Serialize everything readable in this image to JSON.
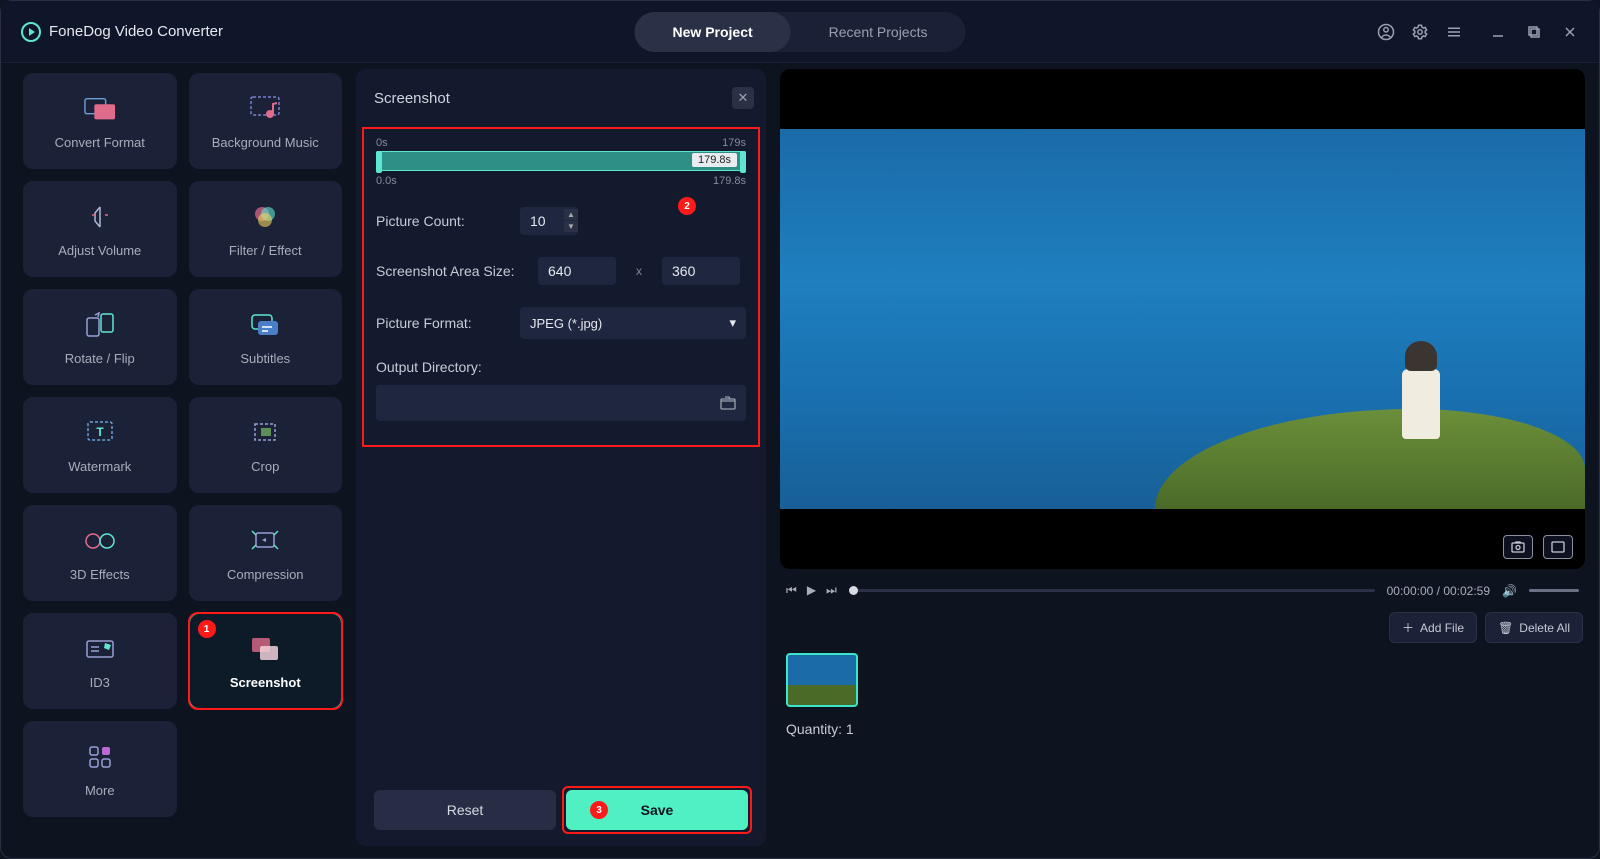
{
  "app": {
    "title": "FoneDog Video Converter"
  },
  "tabs": {
    "new": "New Project",
    "recent": "Recent Projects"
  },
  "sidebar": {
    "items": [
      {
        "label": "Convert Format"
      },
      {
        "label": "Background Music"
      },
      {
        "label": "Adjust Volume"
      },
      {
        "label": "Filter / Effect"
      },
      {
        "label": "Rotate / Flip"
      },
      {
        "label": "Subtitles"
      },
      {
        "label": "Watermark"
      },
      {
        "label": "Crop"
      },
      {
        "label": "3D Effects"
      },
      {
        "label": "Compression"
      },
      {
        "label": "ID3"
      },
      {
        "label": "Screenshot"
      },
      {
        "label": "More"
      }
    ]
  },
  "panel": {
    "title": "Screenshot",
    "range": {
      "startTop": "0s",
      "endTop": "179s",
      "tag": "179.8s",
      "startBot": "0.0s",
      "endBot": "179.8s"
    },
    "picCountLabel": "Picture Count:",
    "picCountVal": "10",
    "areaLabel": "Screenshot Area Size:",
    "areaW": "640",
    "areaSep": "x",
    "areaH": "360",
    "formatLabel": "Picture Format:",
    "formatVal": "JPEG (*.jpg)",
    "outDirLabel": "Output Directory:",
    "reset": "Reset",
    "save": "Save"
  },
  "callouts": {
    "one": "1",
    "two": "2",
    "three": "3"
  },
  "player": {
    "time": "00:00:00 / 00:02:59"
  },
  "queue": {
    "addFile": "Add File",
    "deleteAll": "Delete All",
    "qtyLabel": "Quantity:",
    "qtyVal": "1"
  }
}
